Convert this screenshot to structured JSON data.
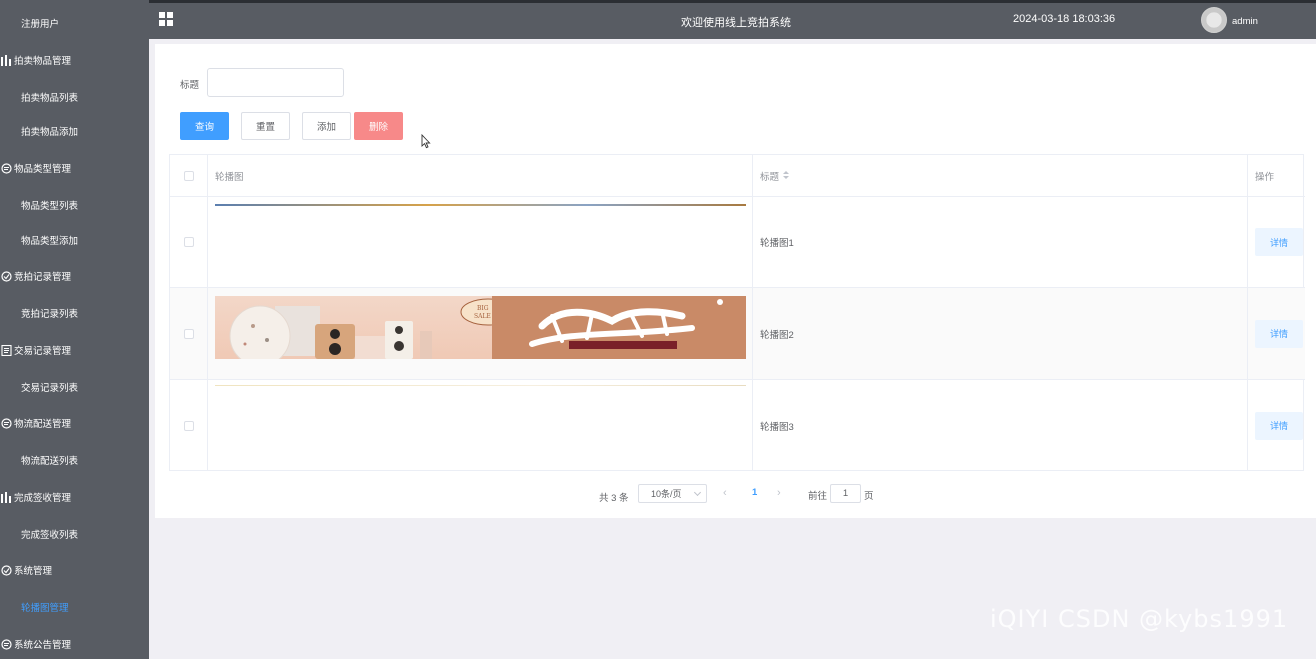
{
  "header": {
    "title": "欢迎使用线上竞拍系统",
    "datetime": "2024-03-18 18:03:36",
    "username": "admin"
  },
  "sidebar": {
    "items": [
      {
        "label": "注册用户",
        "type": "sub"
      },
      {
        "label": "拍卖物品管理",
        "type": "group",
        "icon": "bar-chart-icon"
      },
      {
        "label": "拍卖物品列表",
        "type": "sub"
      },
      {
        "label": "拍卖物品添加",
        "type": "sub"
      },
      {
        "label": "物品类型管理",
        "type": "group",
        "icon": "chat-icon"
      },
      {
        "label": "物品类型列表",
        "type": "sub"
      },
      {
        "label": "物品类型添加",
        "type": "sub"
      },
      {
        "label": "竞拍记录管理",
        "type": "group",
        "icon": "check-circle-icon"
      },
      {
        "label": "竞拍记录列表",
        "type": "sub"
      },
      {
        "label": "交易记录管理",
        "type": "group",
        "icon": "document-icon"
      },
      {
        "label": "交易记录列表",
        "type": "sub"
      },
      {
        "label": "物流配送管理",
        "type": "group",
        "icon": "chat-icon"
      },
      {
        "label": "物流配送列表",
        "type": "sub"
      },
      {
        "label": "完成签收管理",
        "type": "group",
        "icon": "bar-chart-icon"
      },
      {
        "label": "完成签收列表",
        "type": "sub"
      },
      {
        "label": "系统管理",
        "type": "group",
        "icon": "check-circle-icon"
      },
      {
        "label": "轮播图管理",
        "type": "sub",
        "active": true
      },
      {
        "label": "系统公告管理",
        "type": "group",
        "icon": "chat-icon"
      }
    ]
  },
  "search": {
    "label": "标题",
    "value": "",
    "placeholder": ""
  },
  "buttons": {
    "query": "查询",
    "reset": "重置",
    "add": "添加",
    "delete": "删除"
  },
  "table": {
    "columns": [
      "轮播图",
      "标题",
      "操作"
    ],
    "rows": [
      {
        "title": "轮播图1",
        "action": "详情"
      },
      {
        "title": "轮播图2",
        "action": "详情"
      },
      {
        "title": "轮播图3",
        "action": "详情"
      }
    ]
  },
  "pagination": {
    "total": "共 3 条",
    "page_size": "10条/页",
    "current_page": "1",
    "goto_label": "前往",
    "goto_value": "1",
    "page_suffix": "页"
  },
  "watermark": "iQIYI CSDN @kybs1991",
  "colors": {
    "sidebar_bg": "#585c63",
    "primary": "#409eff",
    "danger": "#f78989",
    "active_menu": "#409eff"
  }
}
